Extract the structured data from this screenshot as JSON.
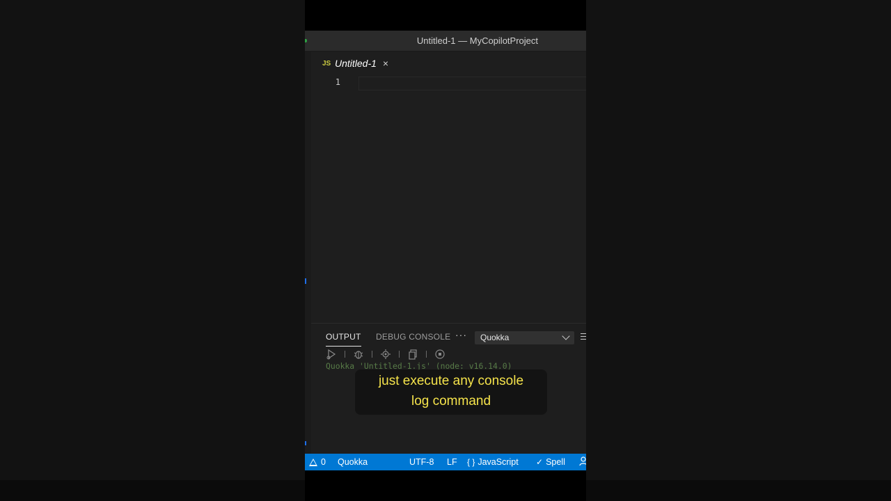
{
  "window": {
    "title": "Untitled-1 — MyCopilotProject"
  },
  "tab": {
    "lang_badge": "JS",
    "label": "Untitled-1",
    "close_glyph": "×"
  },
  "editor": {
    "line_numbers": [
      "1"
    ]
  },
  "panel": {
    "tabs": [
      {
        "label": "OUTPUT",
        "active": true
      },
      {
        "label": "DEBUG CONSOLE",
        "active": false
      }
    ],
    "more_glyph": "···",
    "channel": "Quokka",
    "toolbar_icons": [
      "play-coverage-icon",
      "debug-icon",
      "settings-bug-icon",
      "copy-icon",
      "stop-icon"
    ],
    "output_lines": [
      "Quokka 'Untitled-1.js' (node: v16.14.0)"
    ]
  },
  "caption": {
    "line1": "just execute any console",
    "line2": "log command"
  },
  "statusbar": {
    "problems": "0",
    "quokka": "Quokka",
    "encoding": "UTF-8",
    "eol": "LF",
    "language_glyph": "{ }",
    "language": "JavaScript",
    "spell_glyph": "✓",
    "spell": "Spell",
    "accent": "#0078d4"
  }
}
